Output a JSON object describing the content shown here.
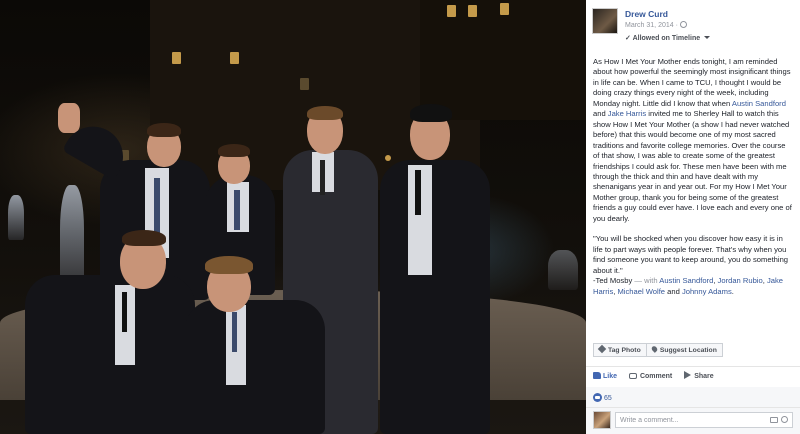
{
  "post": {
    "author": "Drew Curd",
    "date": "March 31, 2014",
    "date_separator": "·",
    "audience": "Allowed on Timeline",
    "body": {
      "p1_a": "As How I Met Your Mother ends tonight, I am reminded about how powerful the seemingly most insignificant things in life can be. When I came to TCU, I thought I would be doing crazy things every night of the week, including Monday night. Little did I know that when ",
      "link_austin": "Austin Sandford",
      "p1_b": " and ",
      "link_jake": "Jake Harris",
      "p1_c": " invited me to Sherley Hall to watch this show How I Met Your Mother (a show I had never watched before) that this would become one of my most sacred traditions and favorite college memories. Over the course of that show, I was able to create some of the greatest friendships I could ask for. These men have been with me through the thick and thin and have dealt with my shenanigans year in and year out. For my How I Met Your Mother group, thank you for being some of the greatest friends a guy could ever have. I love each and every one of you dearly.",
      "quote": "\"You will be shocked when you discover how easy it is in life to part ways with people forever. That's why when you find someone you want to keep around, you do something about it.\"",
      "attribution": "-Ted Mosby",
      "with_text": " — with ",
      "tags": [
        "Austin Sandford",
        "Jordan Rubio",
        "Jake Harris",
        "Michael Wolfe",
        "Johnny Adams"
      ],
      "sep_comma": ", ",
      "sep_and": " and ",
      "end": "."
    },
    "buttons": {
      "tag_photo": "Tag Photo",
      "suggest_location": "Suggest Location"
    },
    "actions": {
      "like": "Like",
      "comment": "Comment",
      "share": "Share"
    },
    "likes_count": "65",
    "comment_placeholder": "Write a comment...",
    "colors": {
      "link": "#365899",
      "facebook_blue": "#4267b2"
    }
  }
}
